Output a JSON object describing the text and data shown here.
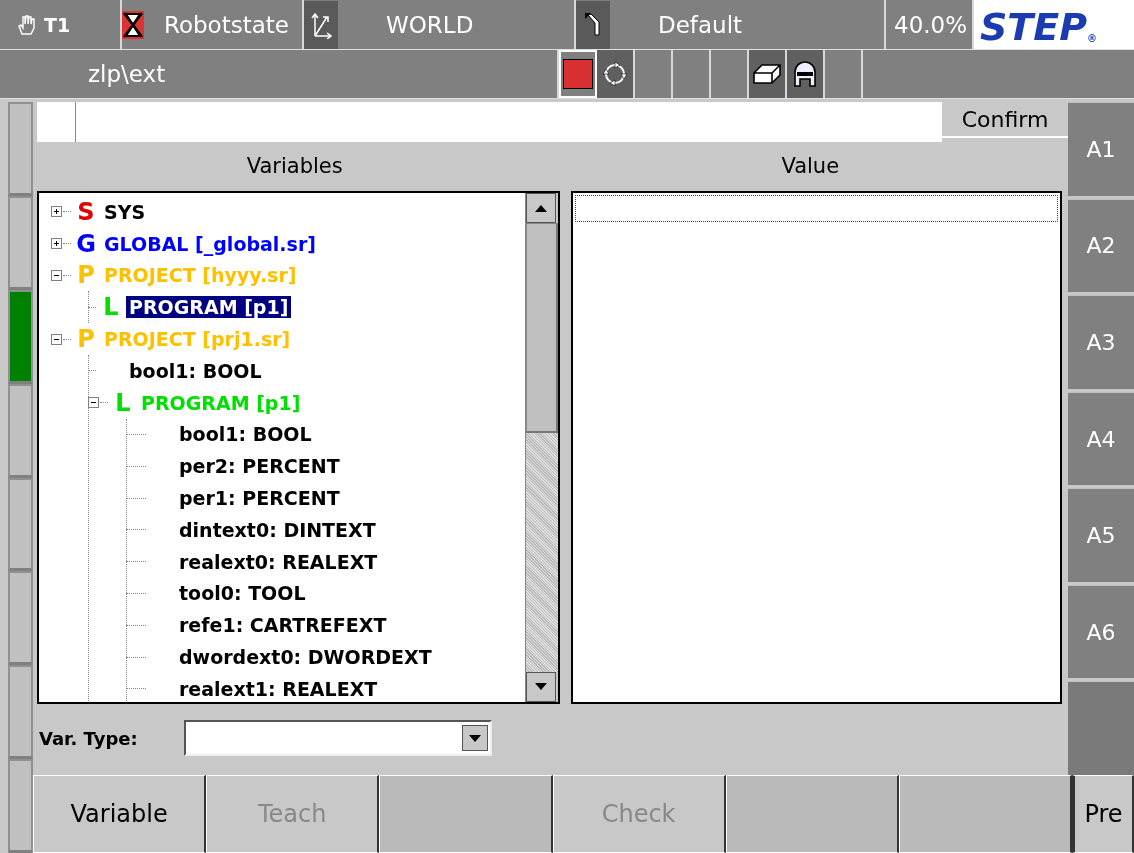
{
  "status_bar": {
    "mode": "T1",
    "robot_state": "Robotstate",
    "coord_system": "WORLD",
    "tool": "Default",
    "override": "40.0%",
    "logo": "STEP",
    "logo_mark": "®",
    "path": "zlp\\ext",
    "stopped": true
  },
  "left_strip": [
    {
      "on": false
    },
    {
      "on": false
    },
    {
      "on": true
    },
    {
      "on": false
    },
    {
      "on": false
    },
    {
      "on": false
    },
    {
      "on": false
    },
    {
      "on": false
    }
  ],
  "input": {
    "confirm_button": "Confirm"
  },
  "columns": [
    "Variables",
    "Value"
  ],
  "tree": [
    {
      "letter": "S",
      "label": "SYS",
      "kind": "sys",
      "expanded": false,
      "selected": false
    },
    {
      "letter": "G",
      "label": "GLOBAL [_global.sr]",
      "kind": "global",
      "expanded": false,
      "selected": false
    },
    {
      "letter": "P",
      "label": "PROJECT [hyyy.sr]",
      "kind": "project",
      "expanded": true,
      "selected": false,
      "children": [
        {
          "letter": "L",
          "label": "PROGRAM [p1]",
          "kind": "program",
          "selected": true
        }
      ]
    },
    {
      "letter": "P",
      "label": "PROJECT [prj1.sr]",
      "kind": "project",
      "expanded": true,
      "selected": false,
      "children": [
        {
          "label": "bool1: BOOL",
          "kind": "variable",
          "selected": false
        },
        {
          "letter": "L",
          "label": "PROGRAM [p1]",
          "kind": "program",
          "expanded": true,
          "selected": false,
          "children": [
            {
              "label": "bool1: BOOL",
              "kind": "variable",
              "selected": false
            },
            {
              "label": "per2: PERCENT",
              "kind": "variable",
              "selected": false
            },
            {
              "label": "per1: PERCENT",
              "kind": "variable",
              "selected": false
            },
            {
              "label": "dintext0: DINTEXT",
              "kind": "variable",
              "selected": false
            },
            {
              "label": "realext0: REALEXT",
              "kind": "variable",
              "selected": false
            },
            {
              "label": "tool0: TOOL",
              "kind": "variable",
              "selected": false
            },
            {
              "label": "refe1: CARTREFEXT",
              "kind": "variable",
              "selected": false
            },
            {
              "label": "dwordext0: DWORDEXT",
              "kind": "variable",
              "selected": false
            },
            {
              "label": "realext1: REALEXT",
              "kind": "variable",
              "selected": false
            }
          ]
        }
      ]
    }
  ],
  "var_type": {
    "label": "Var. Type:"
  },
  "side_buttons": [
    {
      "label": "A1"
    },
    {
      "label": "A2"
    },
    {
      "label": "A3"
    },
    {
      "label": "A4"
    },
    {
      "label": "A5"
    },
    {
      "label": "A6"
    },
    {
      "kind": "blank"
    }
  ],
  "bottom_buttons": [
    {
      "label": "Variable",
      "disabled": false
    },
    {
      "label": "Teach",
      "disabled": true
    },
    {
      "kind": "blank"
    },
    {
      "label": "Check",
      "disabled": true
    },
    {
      "kind": "blank"
    },
    {
      "kind": "blank"
    },
    {
      "label": "Pre",
      "disabled": false
    }
  ]
}
